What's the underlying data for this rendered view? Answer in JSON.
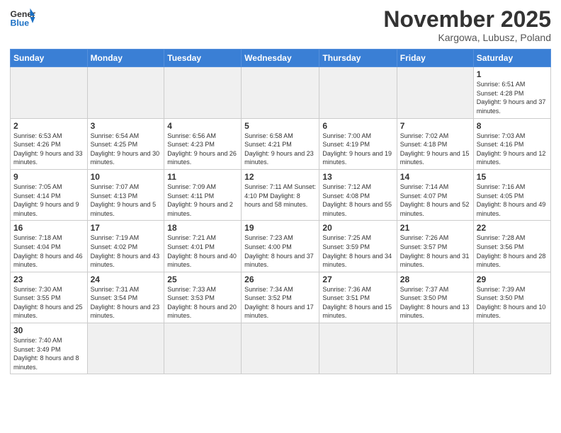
{
  "header": {
    "logo_general": "General",
    "logo_blue": "Blue",
    "month_title": "November 2025",
    "subtitle": "Kargowa, Lubusz, Poland"
  },
  "weekdays": [
    "Sunday",
    "Monday",
    "Tuesday",
    "Wednesday",
    "Thursday",
    "Friday",
    "Saturday"
  ],
  "weeks": [
    [
      {
        "day": "",
        "info": ""
      },
      {
        "day": "",
        "info": ""
      },
      {
        "day": "",
        "info": ""
      },
      {
        "day": "",
        "info": ""
      },
      {
        "day": "",
        "info": ""
      },
      {
        "day": "",
        "info": ""
      },
      {
        "day": "1",
        "info": "Sunrise: 6:51 AM\nSunset: 4:28 PM\nDaylight: 9 hours\nand 37 minutes."
      }
    ],
    [
      {
        "day": "2",
        "info": "Sunrise: 6:53 AM\nSunset: 4:26 PM\nDaylight: 9 hours\nand 33 minutes."
      },
      {
        "day": "3",
        "info": "Sunrise: 6:54 AM\nSunset: 4:25 PM\nDaylight: 9 hours\nand 30 minutes."
      },
      {
        "day": "4",
        "info": "Sunrise: 6:56 AM\nSunset: 4:23 PM\nDaylight: 9 hours\nand 26 minutes."
      },
      {
        "day": "5",
        "info": "Sunrise: 6:58 AM\nSunset: 4:21 PM\nDaylight: 9 hours\nand 23 minutes."
      },
      {
        "day": "6",
        "info": "Sunrise: 7:00 AM\nSunset: 4:19 PM\nDaylight: 9 hours\nand 19 minutes."
      },
      {
        "day": "7",
        "info": "Sunrise: 7:02 AM\nSunset: 4:18 PM\nDaylight: 9 hours\nand 15 minutes."
      },
      {
        "day": "8",
        "info": "Sunrise: 7:03 AM\nSunset: 4:16 PM\nDaylight: 9 hours\nand 12 minutes."
      }
    ],
    [
      {
        "day": "9",
        "info": "Sunrise: 7:05 AM\nSunset: 4:14 PM\nDaylight: 9 hours\nand 9 minutes."
      },
      {
        "day": "10",
        "info": "Sunrise: 7:07 AM\nSunset: 4:13 PM\nDaylight: 9 hours\nand 5 minutes."
      },
      {
        "day": "11",
        "info": "Sunrise: 7:09 AM\nSunset: 4:11 PM\nDaylight: 9 hours\nand 2 minutes."
      },
      {
        "day": "12",
        "info": "Sunrise: 7:11 AM\nSunset: 4:10 PM\nDaylight: 8 hours\nand 58 minutes."
      },
      {
        "day": "13",
        "info": "Sunrise: 7:12 AM\nSunset: 4:08 PM\nDaylight: 8 hours\nand 55 minutes."
      },
      {
        "day": "14",
        "info": "Sunrise: 7:14 AM\nSunset: 4:07 PM\nDaylight: 8 hours\nand 52 minutes."
      },
      {
        "day": "15",
        "info": "Sunrise: 7:16 AM\nSunset: 4:05 PM\nDaylight: 8 hours\nand 49 minutes."
      }
    ],
    [
      {
        "day": "16",
        "info": "Sunrise: 7:18 AM\nSunset: 4:04 PM\nDaylight: 8 hours\nand 46 minutes."
      },
      {
        "day": "17",
        "info": "Sunrise: 7:19 AM\nSunset: 4:02 PM\nDaylight: 8 hours\nand 43 minutes."
      },
      {
        "day": "18",
        "info": "Sunrise: 7:21 AM\nSunset: 4:01 PM\nDaylight: 8 hours\nand 40 minutes."
      },
      {
        "day": "19",
        "info": "Sunrise: 7:23 AM\nSunset: 4:00 PM\nDaylight: 8 hours\nand 37 minutes."
      },
      {
        "day": "20",
        "info": "Sunrise: 7:25 AM\nSunset: 3:59 PM\nDaylight: 8 hours\nand 34 minutes."
      },
      {
        "day": "21",
        "info": "Sunrise: 7:26 AM\nSunset: 3:57 PM\nDaylight: 8 hours\nand 31 minutes."
      },
      {
        "day": "22",
        "info": "Sunrise: 7:28 AM\nSunset: 3:56 PM\nDaylight: 8 hours\nand 28 minutes."
      }
    ],
    [
      {
        "day": "23",
        "info": "Sunrise: 7:30 AM\nSunset: 3:55 PM\nDaylight: 8 hours\nand 25 minutes."
      },
      {
        "day": "24",
        "info": "Sunrise: 7:31 AM\nSunset: 3:54 PM\nDaylight: 8 hours\nand 23 minutes."
      },
      {
        "day": "25",
        "info": "Sunrise: 7:33 AM\nSunset: 3:53 PM\nDaylight: 8 hours\nand 20 minutes."
      },
      {
        "day": "26",
        "info": "Sunrise: 7:34 AM\nSunset: 3:52 PM\nDaylight: 8 hours\nand 17 minutes."
      },
      {
        "day": "27",
        "info": "Sunrise: 7:36 AM\nSunset: 3:51 PM\nDaylight: 8 hours\nand 15 minutes."
      },
      {
        "day": "28",
        "info": "Sunrise: 7:37 AM\nSunset: 3:50 PM\nDaylight: 8 hours\nand 13 minutes."
      },
      {
        "day": "29",
        "info": "Sunrise: 7:39 AM\nSunset: 3:50 PM\nDaylight: 8 hours\nand 10 minutes."
      }
    ],
    [
      {
        "day": "30",
        "info": "Sunrise: 7:40 AM\nSunset: 3:49 PM\nDaylight: 8 hours\nand 8 minutes."
      },
      {
        "day": "",
        "info": ""
      },
      {
        "day": "",
        "info": ""
      },
      {
        "day": "",
        "info": ""
      },
      {
        "day": "",
        "info": ""
      },
      {
        "day": "",
        "info": ""
      },
      {
        "day": "",
        "info": ""
      }
    ]
  ]
}
